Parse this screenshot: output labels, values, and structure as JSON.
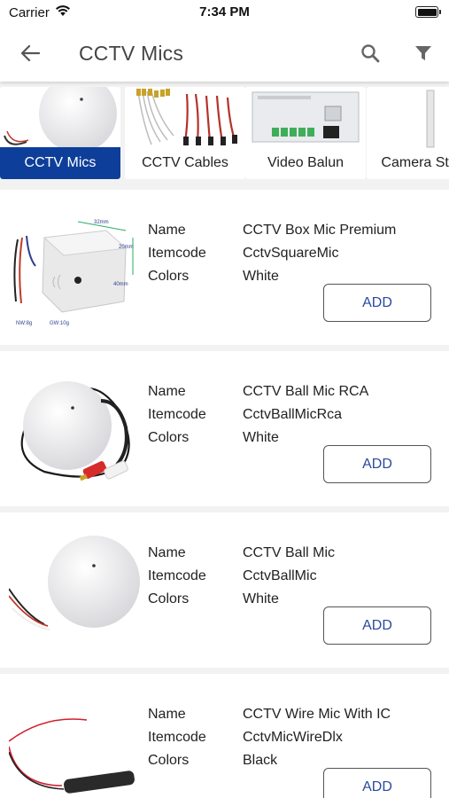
{
  "status_bar": {
    "carrier": "Carrier",
    "time": "7:34 PM"
  },
  "app_bar": {
    "title": "CCTV Mics"
  },
  "categories": [
    {
      "label": "CCTV Mics",
      "active": true
    },
    {
      "label": "CCTV Cables",
      "active": false
    },
    {
      "label": "Video Balun",
      "active": false
    },
    {
      "label": "Camera Stand",
      "active": false
    }
  ],
  "field_labels": {
    "name": "Name",
    "itemcode": "Itemcode",
    "colors": "Colors"
  },
  "add_label": "ADD",
  "products": [
    {
      "name": "CCTV Box Mic Premium",
      "itemcode": "CctvSquareMic",
      "colors": "White",
      "image_text": [
        "32mm",
        "20mm",
        "40mm",
        "NW:8g",
        "GW:10g"
      ]
    },
    {
      "name": "CCTV Ball Mic RCA",
      "itemcode": "CctvBallMicRca",
      "colors": "White"
    },
    {
      "name": "CCTV Ball Mic",
      "itemcode": "CctvBallMic",
      "colors": "White"
    },
    {
      "name": "CCTV Wire Mic With IC",
      "itemcode": "CctvMicWireDlx",
      "colors": "Black"
    }
  ],
  "colors": {
    "accent": "#0d3f9a",
    "add_text": "#2a4a9e"
  }
}
